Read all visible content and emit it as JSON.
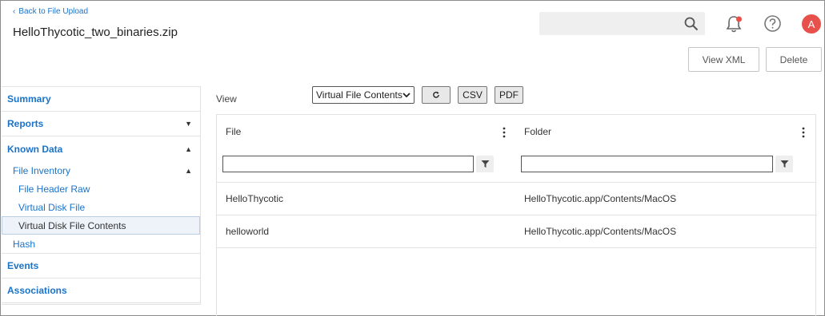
{
  "header": {
    "back_link": "Back to File Upload",
    "title": "HelloThycotic_two_binaries.zip",
    "search_placeholder": "",
    "avatar_initial": "A",
    "view_xml_label": "View XML",
    "delete_label": "Delete",
    "accent_color": "#1a73c9",
    "avatar_color": "#e8514b"
  },
  "sidebar": {
    "summary": "Summary",
    "reports": "Reports",
    "known_data": "Known Data",
    "file_inventory": "File Inventory",
    "file_header_raw": "File Header Raw",
    "virtual_disk_file": "Virtual Disk File",
    "virtual_disk_file_contents": "Virtual Disk File Contents",
    "hash": "Hash",
    "events": "Events",
    "associations": "Associations"
  },
  "toolbar": {
    "view_label": "View",
    "view_select_value": "Virtual File Contents",
    "refresh_icon": "refresh-icon",
    "csv_label": "CSV",
    "pdf_label": "PDF"
  },
  "grid": {
    "columns": [
      "File",
      "Folder"
    ],
    "rows": [
      {
        "file": "HelloThycotic",
        "folder": "HelloThycotic.app/Contents/MacOS"
      },
      {
        "file": "helloworld",
        "folder": "HelloThycotic.app/Contents/MacOS"
      }
    ]
  }
}
